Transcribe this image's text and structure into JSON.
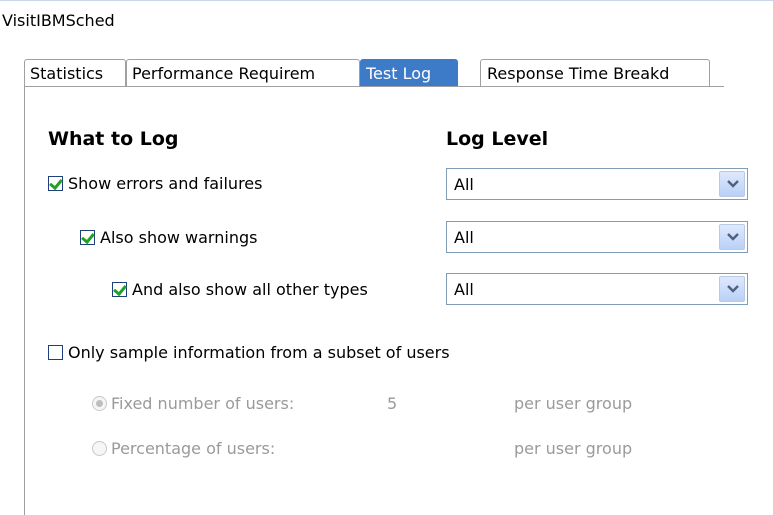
{
  "window": {
    "title": "VisitIBMSched"
  },
  "tabs": [
    {
      "label": "Statistics",
      "active": false
    },
    {
      "label": "Performance Requirem",
      "active": false
    },
    {
      "label": "Test Log",
      "active": true
    },
    {
      "label": "Response Time Breakd",
      "active": false
    }
  ],
  "headings": {
    "what_to_log": "What to Log",
    "log_level": "Log Level"
  },
  "options": [
    {
      "label": "Show errors and failures",
      "checked": true,
      "level": "All"
    },
    {
      "label": "Also show warnings",
      "checked": true,
      "level": "All"
    },
    {
      "label": "And also show all other types",
      "checked": true,
      "level": "All"
    }
  ],
  "sampling": {
    "label": "Only sample information from a subset of users",
    "checked": false,
    "fixed_label": "Fixed number of users:",
    "fixed_value": "5",
    "fixed_suffix": "per user group",
    "percent_label": "Percentage of users:",
    "percent_suffix": "per user group",
    "selected": "fixed"
  },
  "colors": {
    "active_tab": "#3d7bc9",
    "check": "#21a121",
    "disabled_text": "#9a9a9a"
  }
}
